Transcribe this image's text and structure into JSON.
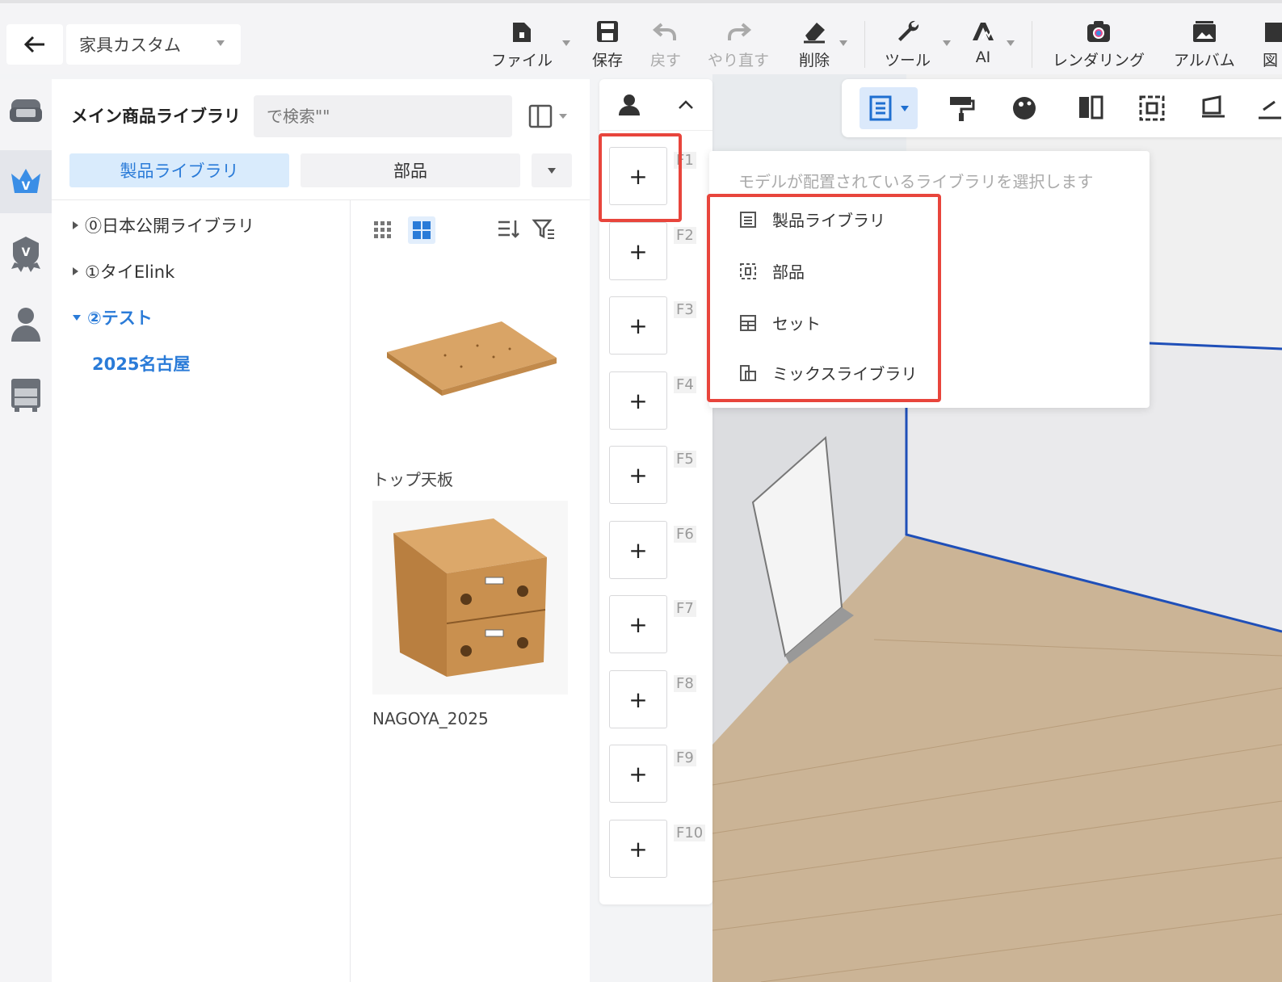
{
  "header": {
    "project_name": "家具カスタム",
    "tools": [
      {
        "label": "ファイル",
        "icon": "file-icon"
      },
      {
        "label": "保存",
        "icon": "save-icon"
      },
      {
        "label": "戻す",
        "icon": "undo-icon"
      },
      {
        "label": "やり直す",
        "icon": "redo-icon"
      },
      {
        "label": "削除",
        "icon": "eraser-icon"
      },
      {
        "label": "ツール",
        "icon": "wrench-icon"
      },
      {
        "label": "AI",
        "icon": "ai-icon"
      },
      {
        "label": "レンダリング",
        "icon": "camera-icon"
      },
      {
        "label": "アルバム",
        "icon": "album-icon"
      },
      {
        "label": "図面",
        "icon": "drawing-icon"
      }
    ]
  },
  "library": {
    "title": "メイン商品ライブラリ",
    "search_placeholder": "で検索\"\"",
    "tabs": [
      "製品ライブラリ",
      "部品"
    ],
    "tree": [
      {
        "label": "⓪日本公開ライブラリ"
      },
      {
        "label": "①タイElink"
      },
      {
        "label": "②テスト"
      }
    ],
    "tree_sub": "2025名古屋",
    "products": [
      {
        "name": "トップ天板"
      },
      {
        "name": "NAGOYA_2025"
      }
    ]
  },
  "fkeys": [
    "F1",
    "F2",
    "F3",
    "F4",
    "F5",
    "F6",
    "F7",
    "F8",
    "F9",
    "F10"
  ],
  "fkey_add": "+",
  "dropdown": {
    "hint": "モデルが配置されているライブラリを選択します",
    "items": [
      {
        "label": "製品ライブラリ",
        "icon": "list-icon"
      },
      {
        "label": "部品",
        "icon": "component-icon"
      },
      {
        "label": "セット",
        "icon": "set-icon"
      },
      {
        "label": "ミックスライブラリ",
        "icon": "mix-library-icon"
      }
    ]
  },
  "colors": {
    "accent": "#2a7bd8",
    "highlight": "#e8453c",
    "wood": "#c98b4a"
  }
}
